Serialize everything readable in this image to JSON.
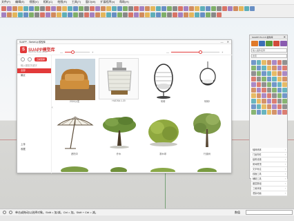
{
  "menu": [
    "文件(F)",
    "编辑(E)",
    "视图(V)",
    "相机(C)",
    "绘图(R)",
    "工具(T)",
    "窗口(W)",
    "扩展程序(x)",
    "帮助(H)"
  ],
  "plugin": {
    "title": "SUAPP - SketchUp 模型库",
    "logo_text": "SUAPP模型库",
    "logo_sub": "SketchUp Model Library",
    "win_min": "—",
    "win_close": "✕",
    "slider1_fill": 0.33,
    "slider2_fill": 0.62,
    "slider_minus": "—",
    "slider_plus": "+",
    "cloud_button": "云模型库",
    "sidebar_header": "输入模型关键字",
    "sidebar_items": [
      "全部",
      "最近"
    ],
    "sidebar_bottom": [
      "上传",
      "收藏"
    ],
    "scroll_left": "‹",
    "items": [
      {
        "caption": "2024沙发"
      },
      {
        "caption": "HUDSA 1.20"
      },
      {
        "caption": "吊椅"
      },
      {
        "caption": "吊椅2"
      },
      {
        "caption": "遮阳伞"
      },
      {
        "caption": "乔木"
      },
      {
        "caption": "灌木球"
      },
      {
        "caption": "行道树"
      }
    ]
  },
  "tray": {
    "title": "SUAPP Pro 3.6 插件库",
    "close": "✕",
    "input_placeholder": "输入插件名称",
    "search_placeholder": "搜索",
    "list": [
      "轴网墙体",
      "门窗构件",
      "建筑设施",
      "房间屋顶",
      "文字标注",
      "线面工具",
      "辅助工具",
      "图层群组",
      "三维体量",
      "渲染动画"
    ]
  },
  "status": {
    "message": "单击或拖动以选择对象。Shift = 加/减。Ctrl = 加。Shift + Ctrl = 减。",
    "measure_label": "数值"
  }
}
